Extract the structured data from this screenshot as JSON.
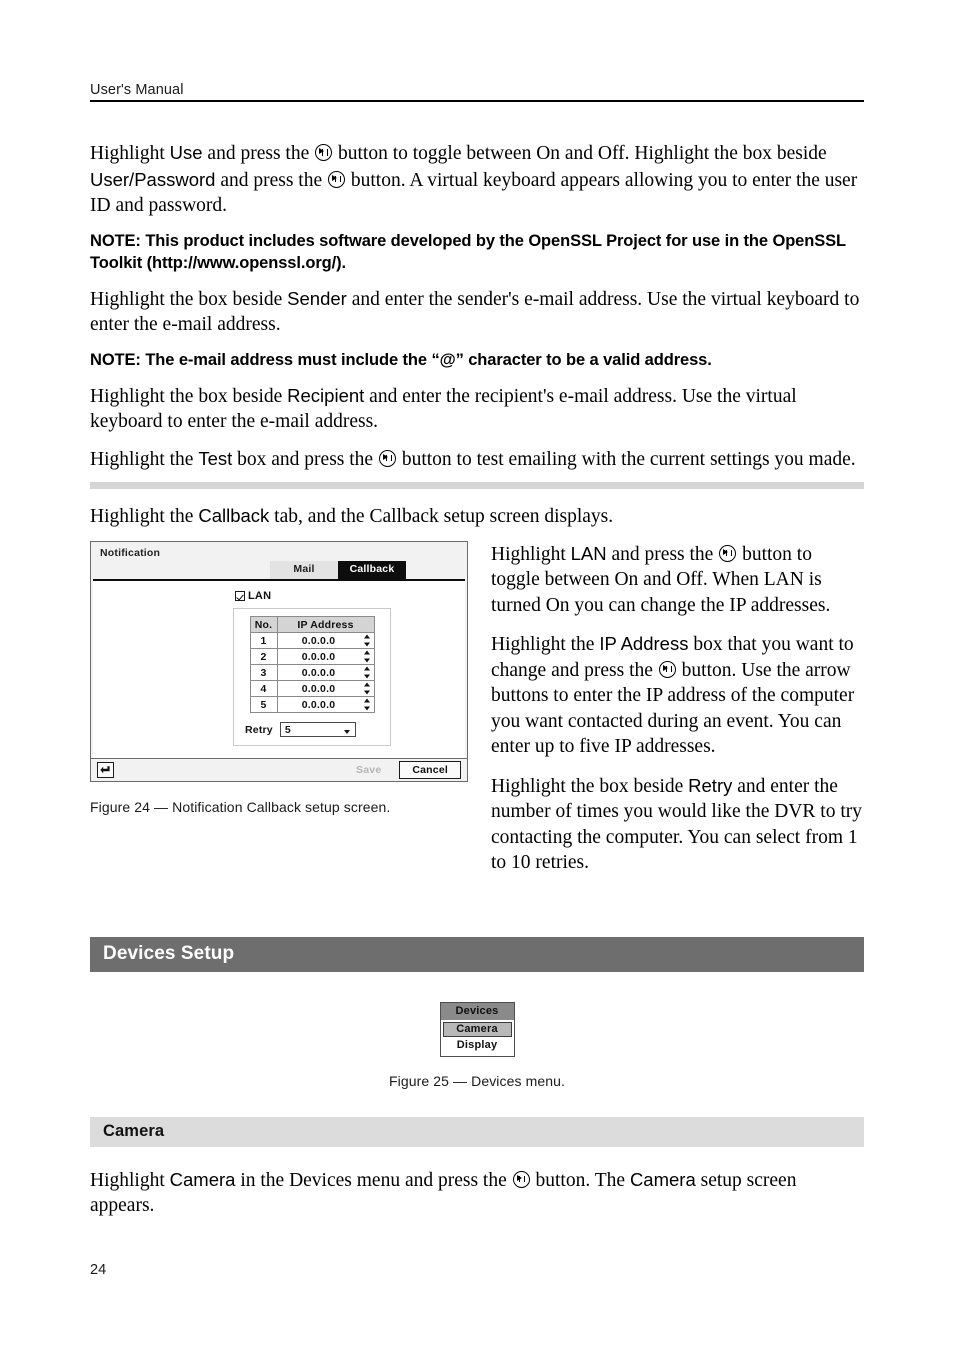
{
  "header": {
    "title": "User's Manual"
  },
  "paragraphs": {
    "p1_a": "Highlight ",
    "p1_use": "Use",
    "p1_b": " and press the ",
    "p1_c": " button to toggle between On and Off.  Highlight the box beside ",
    "p1_userpass": "User/Password",
    "p1_d": " and press the ",
    "p1_e": " button.  A virtual keyboard appears allowing you to enter the user ID and password.",
    "note1": "NOTE:  This product includes software developed by the OpenSSL Project for use in the OpenSSL Toolkit (http://www.openssl.org/).",
    "p2_a": "Highlight the box beside ",
    "p2_sender": "Sender",
    "p2_b": " and enter the sender's e-mail address.  Use the virtual keyboard to enter the e-mail address.",
    "note2": "NOTE:  The e-mail address must include the “@” character to be a valid address.",
    "p3_a": "Highlight the box beside ",
    "p3_recipient": "Recipient",
    "p3_b": " and enter the recipient's e-mail address.  Use the virtual keyboard to enter the e-mail address.",
    "p4_a": "Highlight the ",
    "p4_test": "Test",
    "p4_b": " box and press the ",
    "p4_c": " button to test emailing with the current settings you made.",
    "p5_a": "Highlight the ",
    "p5_callback": "Callback",
    "p5_b": " tab, and the Callback setup screen displays."
  },
  "right_column": {
    "r1_a": "Highlight ",
    "r1_lan": "LAN",
    "r1_b": " and press the ",
    "r1_c": " button to toggle between On and Off.  When LAN is turned On you can change the IP addresses.",
    "r2_a": "Highlight the ",
    "r2_ip": "IP Address",
    "r2_b": " box that you want to change and press the ",
    "r2_c": " button.  Use the arrow buttons to enter the IP address of the computer you want contacted during an event.  You can enter up to five IP addresses.",
    "r3_a": "Highlight the box beside ",
    "r3_retry": "Retry",
    "r3_b": " and enter the number of times you would like the DVR to try contacting the computer.  You can select from 1 to 10 retries."
  },
  "dialog": {
    "title": "Notification",
    "tabs": [
      {
        "label": "Mail",
        "active": false
      },
      {
        "label": "Callback",
        "active": true
      }
    ],
    "lan": {
      "label": "LAN",
      "checked": true
    },
    "table": {
      "columns": [
        "No.",
        "IP Address"
      ],
      "rows": [
        {
          "no": "1",
          "ip": "0.0.0.0"
        },
        {
          "no": "2",
          "ip": "0.0.0.0"
        },
        {
          "no": "3",
          "ip": "0.0.0.0"
        },
        {
          "no": "4",
          "ip": "0.0.0.0"
        },
        {
          "no": "5",
          "ip": "0.0.0.0"
        }
      ]
    },
    "retry": {
      "label": "Retry",
      "value": "5"
    },
    "buttons": {
      "save": "Save",
      "cancel": "Cancel"
    }
  },
  "figure24_caption": "Figure 24 — Notification Callback setup screen.",
  "devices_section": {
    "bar_title": "Devices Setup",
    "menu": {
      "title": "Devices",
      "items": [
        {
          "label": "Camera",
          "selected": true
        },
        {
          "label": "Display",
          "selected": false
        }
      ]
    },
    "caption": "Figure 25 — Devices menu."
  },
  "camera_section": {
    "bar_title": "Camera",
    "p_a": "Highlight ",
    "p_camera1": "Camera",
    "p_b": " in the Devices menu and press the ",
    "p_c": " button.  The ",
    "p_camera2": "Camera",
    "p_d": " setup screen appears."
  },
  "footer": {
    "page_number": "24"
  },
  "colors": {
    "section_bar": "#6e6e6e",
    "subsection_bar": "#dcdcdc",
    "divider": "#d5d5d5",
    "tab_active_bg": "#0d0d0d",
    "tab_inactive_bg": "#e3e3e3",
    "menu_title_bg": "#8a8a8a",
    "menu_selected_bg": "#b8b8b8"
  }
}
